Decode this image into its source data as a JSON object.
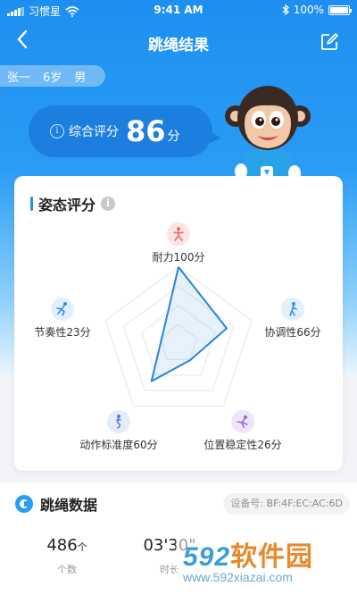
{
  "status_bar": {
    "carrier": "习惯星",
    "time": "9:41 AM",
    "battery": "100%"
  },
  "nav": {
    "title": "跳绳结果",
    "back_icon": "back-chevron-icon",
    "edit_icon": "edit-icon"
  },
  "user": {
    "name": "张一",
    "age": "6岁",
    "gender": "男"
  },
  "overall": {
    "label": "综合评分",
    "score": "86",
    "unit": "分"
  },
  "posture": {
    "title": "姿态评分",
    "dimensions": [
      {
        "label": "耐力100分",
        "score": 100,
        "icon": "endurance-icon",
        "color": "#fde4e4"
      },
      {
        "label": "协调性66分",
        "score": 66,
        "icon": "coordination-icon",
        "color": "#e2f0fd"
      },
      {
        "label": "位置稳定性26分",
        "score": 26,
        "icon": "stability-icon",
        "color": "#efe6fb"
      },
      {
        "label": "动作标准度60分",
        "score": 60,
        "icon": "standard-icon",
        "color": "#e4ecfb"
      },
      {
        "label": "节奏性23分",
        "score": 23,
        "icon": "rhythm-icon",
        "color": "#e2f0fd"
      }
    ]
  },
  "jump_data": {
    "title": "跳绳数据",
    "device_label": "设备号:",
    "device_id": "BF:4F:EC:AC:6D",
    "stats": [
      {
        "value": "486",
        "unit": "个",
        "label": "个数"
      },
      {
        "value": "03'30\"",
        "unit": "",
        "label": "时长"
      },
      {
        "value": "",
        "unit": "",
        "label": ""
      }
    ]
  },
  "watermark": {
    "main_num": "592",
    "main_cn": "软件园",
    "url": "www.592xiazai.com"
  }
}
